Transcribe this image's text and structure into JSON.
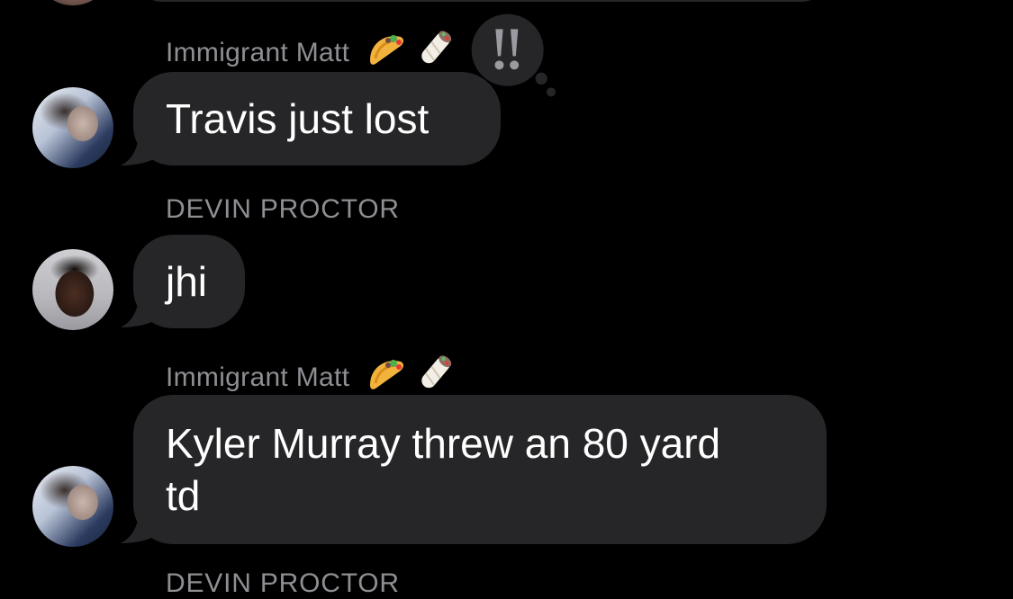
{
  "colors": {
    "background": "#000000",
    "bubble": "#262628",
    "sender_name": "#8e8e93",
    "text": "#ffffff"
  },
  "messages": [
    {
      "sender": "Immigrant Matt",
      "sender_emojis": [
        "taco",
        "burrito"
      ],
      "avatar": "avatar-matt",
      "text": "Travis just lost",
      "reaction": "double-exclamation-icon"
    },
    {
      "sender": "DEVIN PROCTOR",
      "avatar": "avatar-devin",
      "text": "jhi"
    },
    {
      "sender": "Immigrant Matt",
      "sender_emojis": [
        "taco",
        "burrito"
      ],
      "avatar": "avatar-matt",
      "text_line1": "Kyler Murray threw an 80 yard",
      "text_line2": "td"
    },
    {
      "sender": "DEVIN PROCTOR"
    }
  ]
}
